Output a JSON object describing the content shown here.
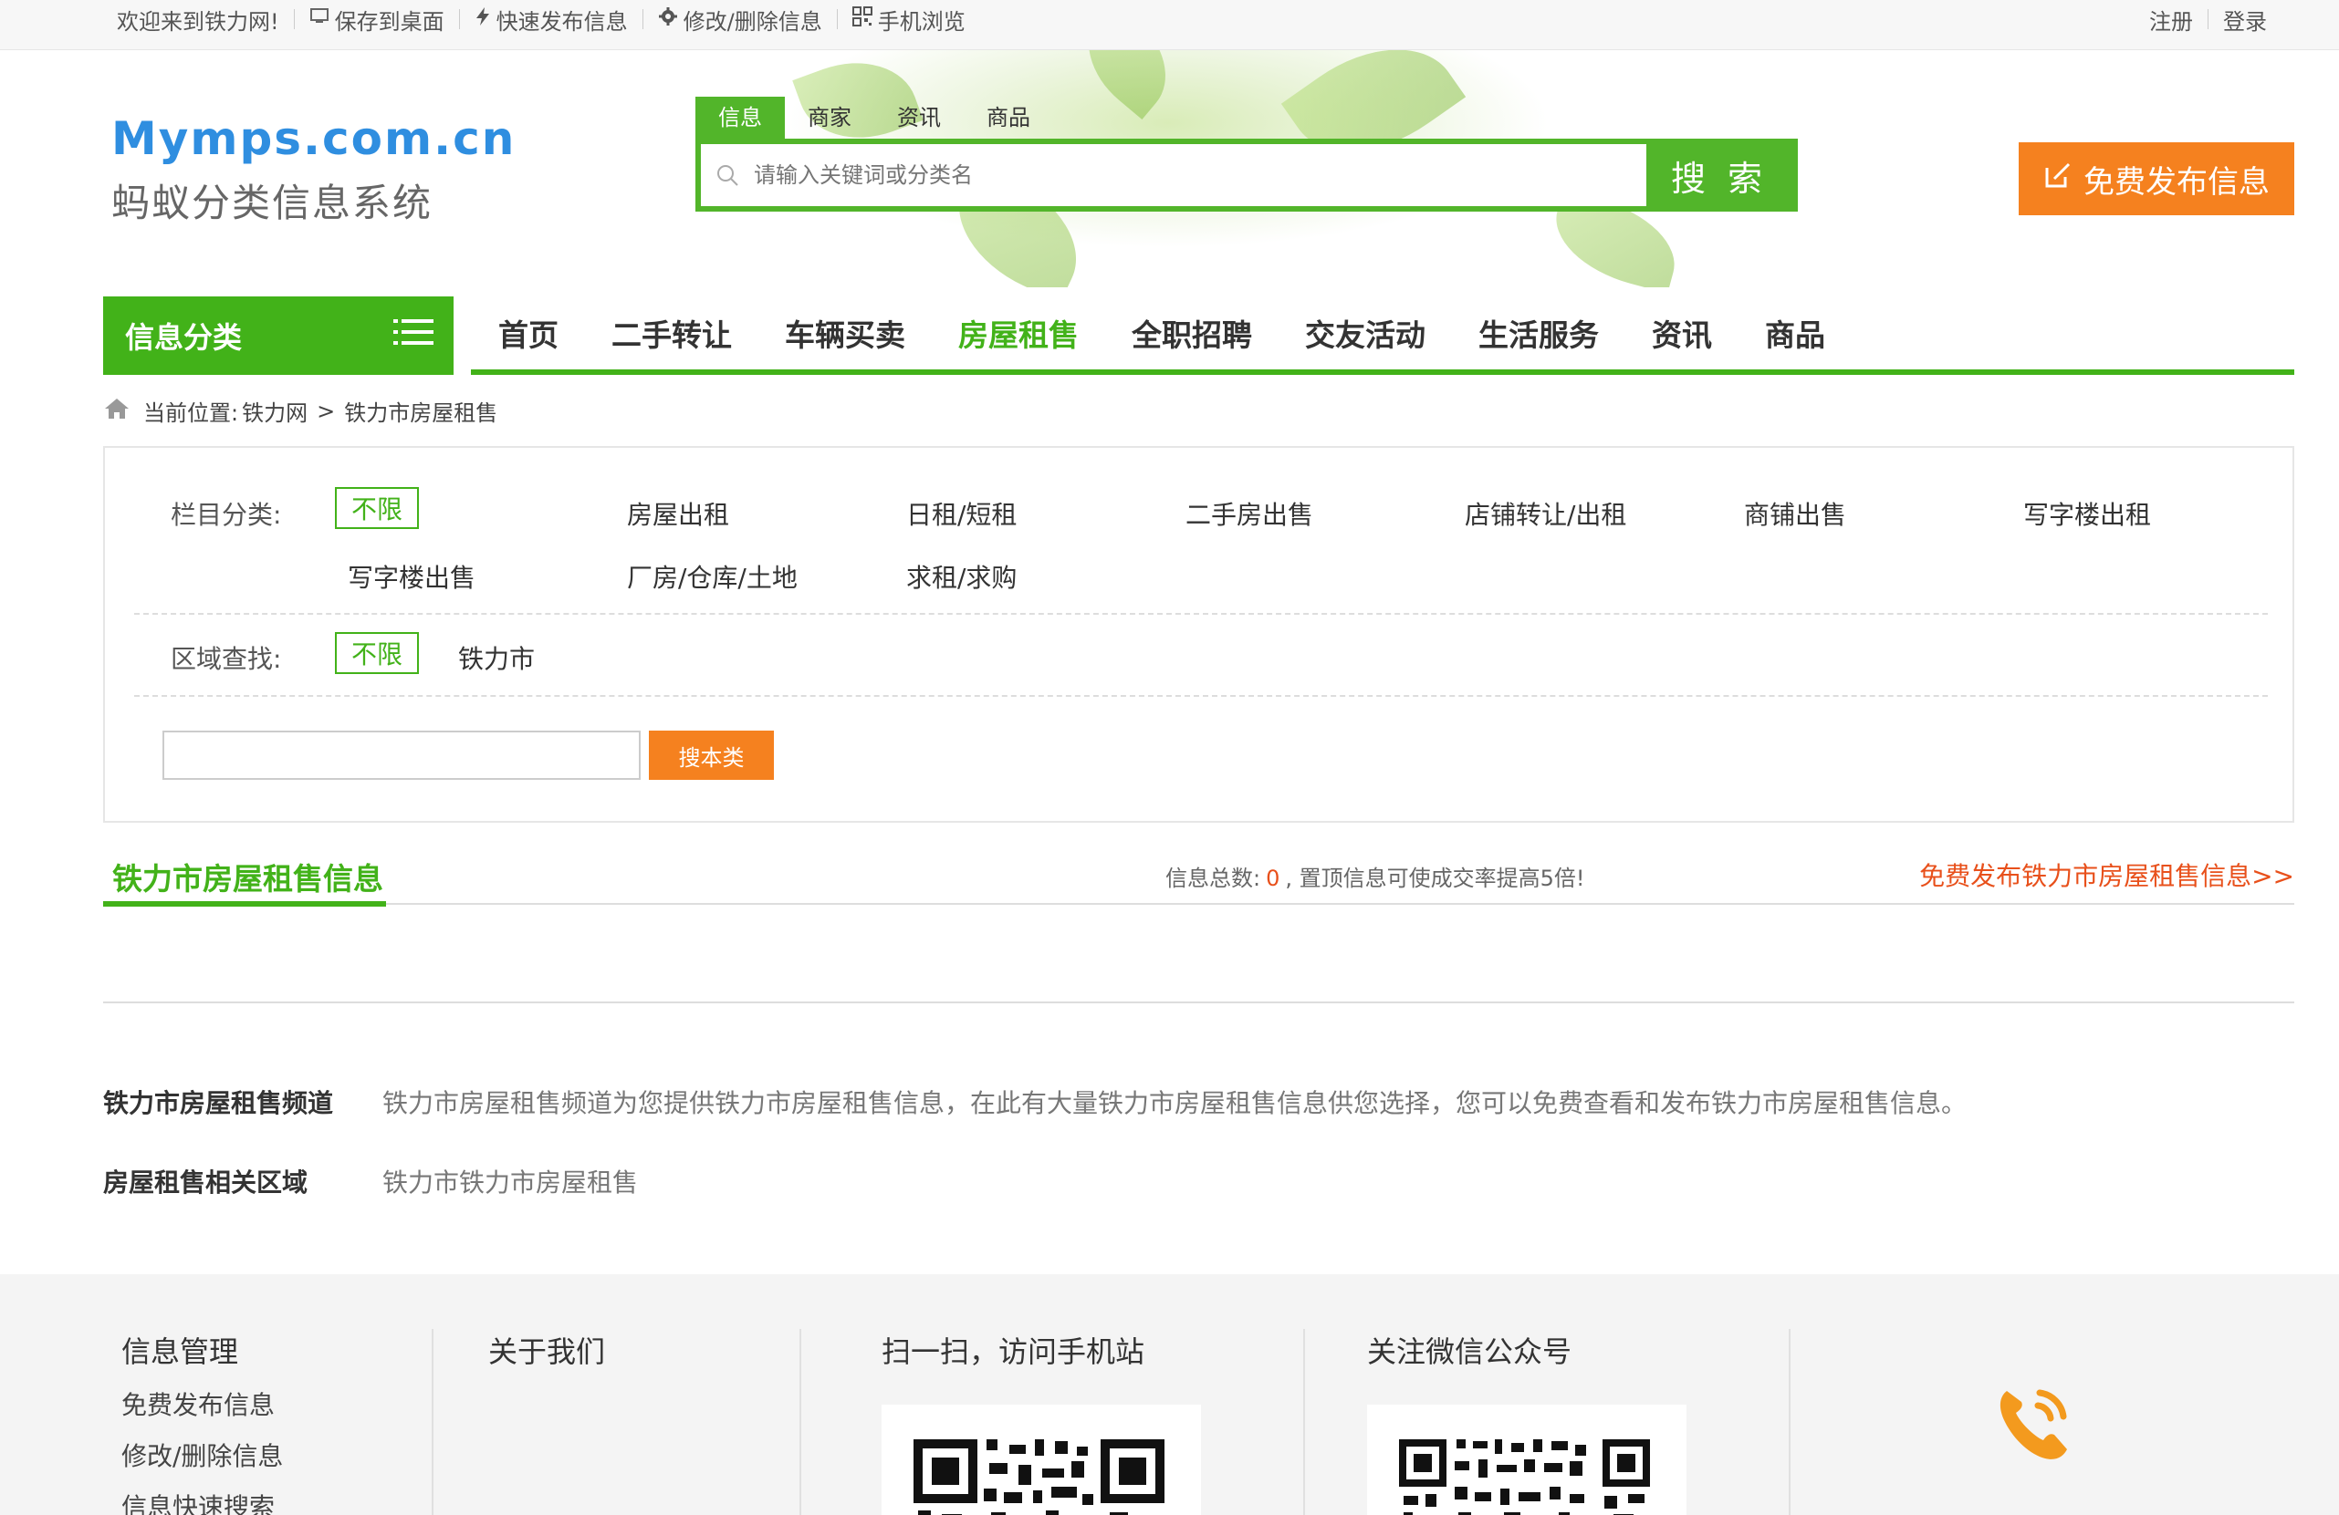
{
  "topbar": {
    "welcome": "欢迎来到铁力网!",
    "save_desktop": "保存到桌面",
    "quick_post": "快速发布信息",
    "edit_delete": "修改/删除信息",
    "mobile_browse": "手机浏览",
    "register": "注册",
    "login": "登录"
  },
  "logo": {
    "en": "Mymps.com.cn",
    "cn": "蚂蚁分类信息系统"
  },
  "search": {
    "tabs": [
      "信息",
      "商家",
      "资讯",
      "商品"
    ],
    "placeholder": "请输入关键词或分类名",
    "button": "搜 索"
  },
  "post_button": "免费发布信息",
  "nav": {
    "category_button": "信息分类",
    "items": [
      "首页",
      "二手转让",
      "车辆买卖",
      "房屋租售",
      "全职招聘",
      "交友活动",
      "生活服务",
      "资讯",
      "商品"
    ],
    "active": "房屋租售"
  },
  "breadcrumb": {
    "prefix": "当前位置:",
    "home": "铁力网",
    "sep": ">",
    "current": "铁力市房屋租售"
  },
  "filter": {
    "category_label": "栏目分类:",
    "nolimit": "不限",
    "categories": [
      "房屋出租",
      "日租/短租",
      "二手房出售",
      "店铺转让/出租",
      "商铺出售",
      "写字楼出租",
      "写字楼出售",
      "厂房/仓库/土地",
      "求租/求购"
    ],
    "area_label": "区域查找:",
    "areas": [
      "铁力市"
    ],
    "search_button": "搜本类",
    "keyword_value": ""
  },
  "section": {
    "title": "铁力市房屋租售信息",
    "count_prefix": "信息总数:",
    "count": "0",
    "count_suffix": ", 置顶信息可使成交率提高5倍!",
    "publish_link": "免费发布铁力市房屋租售信息>>"
  },
  "about": {
    "channel_key": "铁力市房屋租售频道",
    "channel_value": "铁力市房屋租售频道为您提供铁力市房屋租售信息，在此有大量铁力市房屋租售信息供您选择，您可以免费查看和发布铁力市房屋租售信息。",
    "region_key": "房屋租售相关区域",
    "region_value": "铁力市铁力市房屋租售"
  },
  "footer": {
    "col1_title": "信息管理",
    "col1_links": [
      "免费发布信息",
      "修改/删除信息",
      "信息快速搜索"
    ],
    "col2_title": "关于我们",
    "col3_title": "扫一扫，访问手机站",
    "col4_title": "关注微信公众号"
  },
  "colors": {
    "green": "#42b219",
    "orange": "#f5811f",
    "red": "#e8501b",
    "blue": "#2f8ee0"
  }
}
